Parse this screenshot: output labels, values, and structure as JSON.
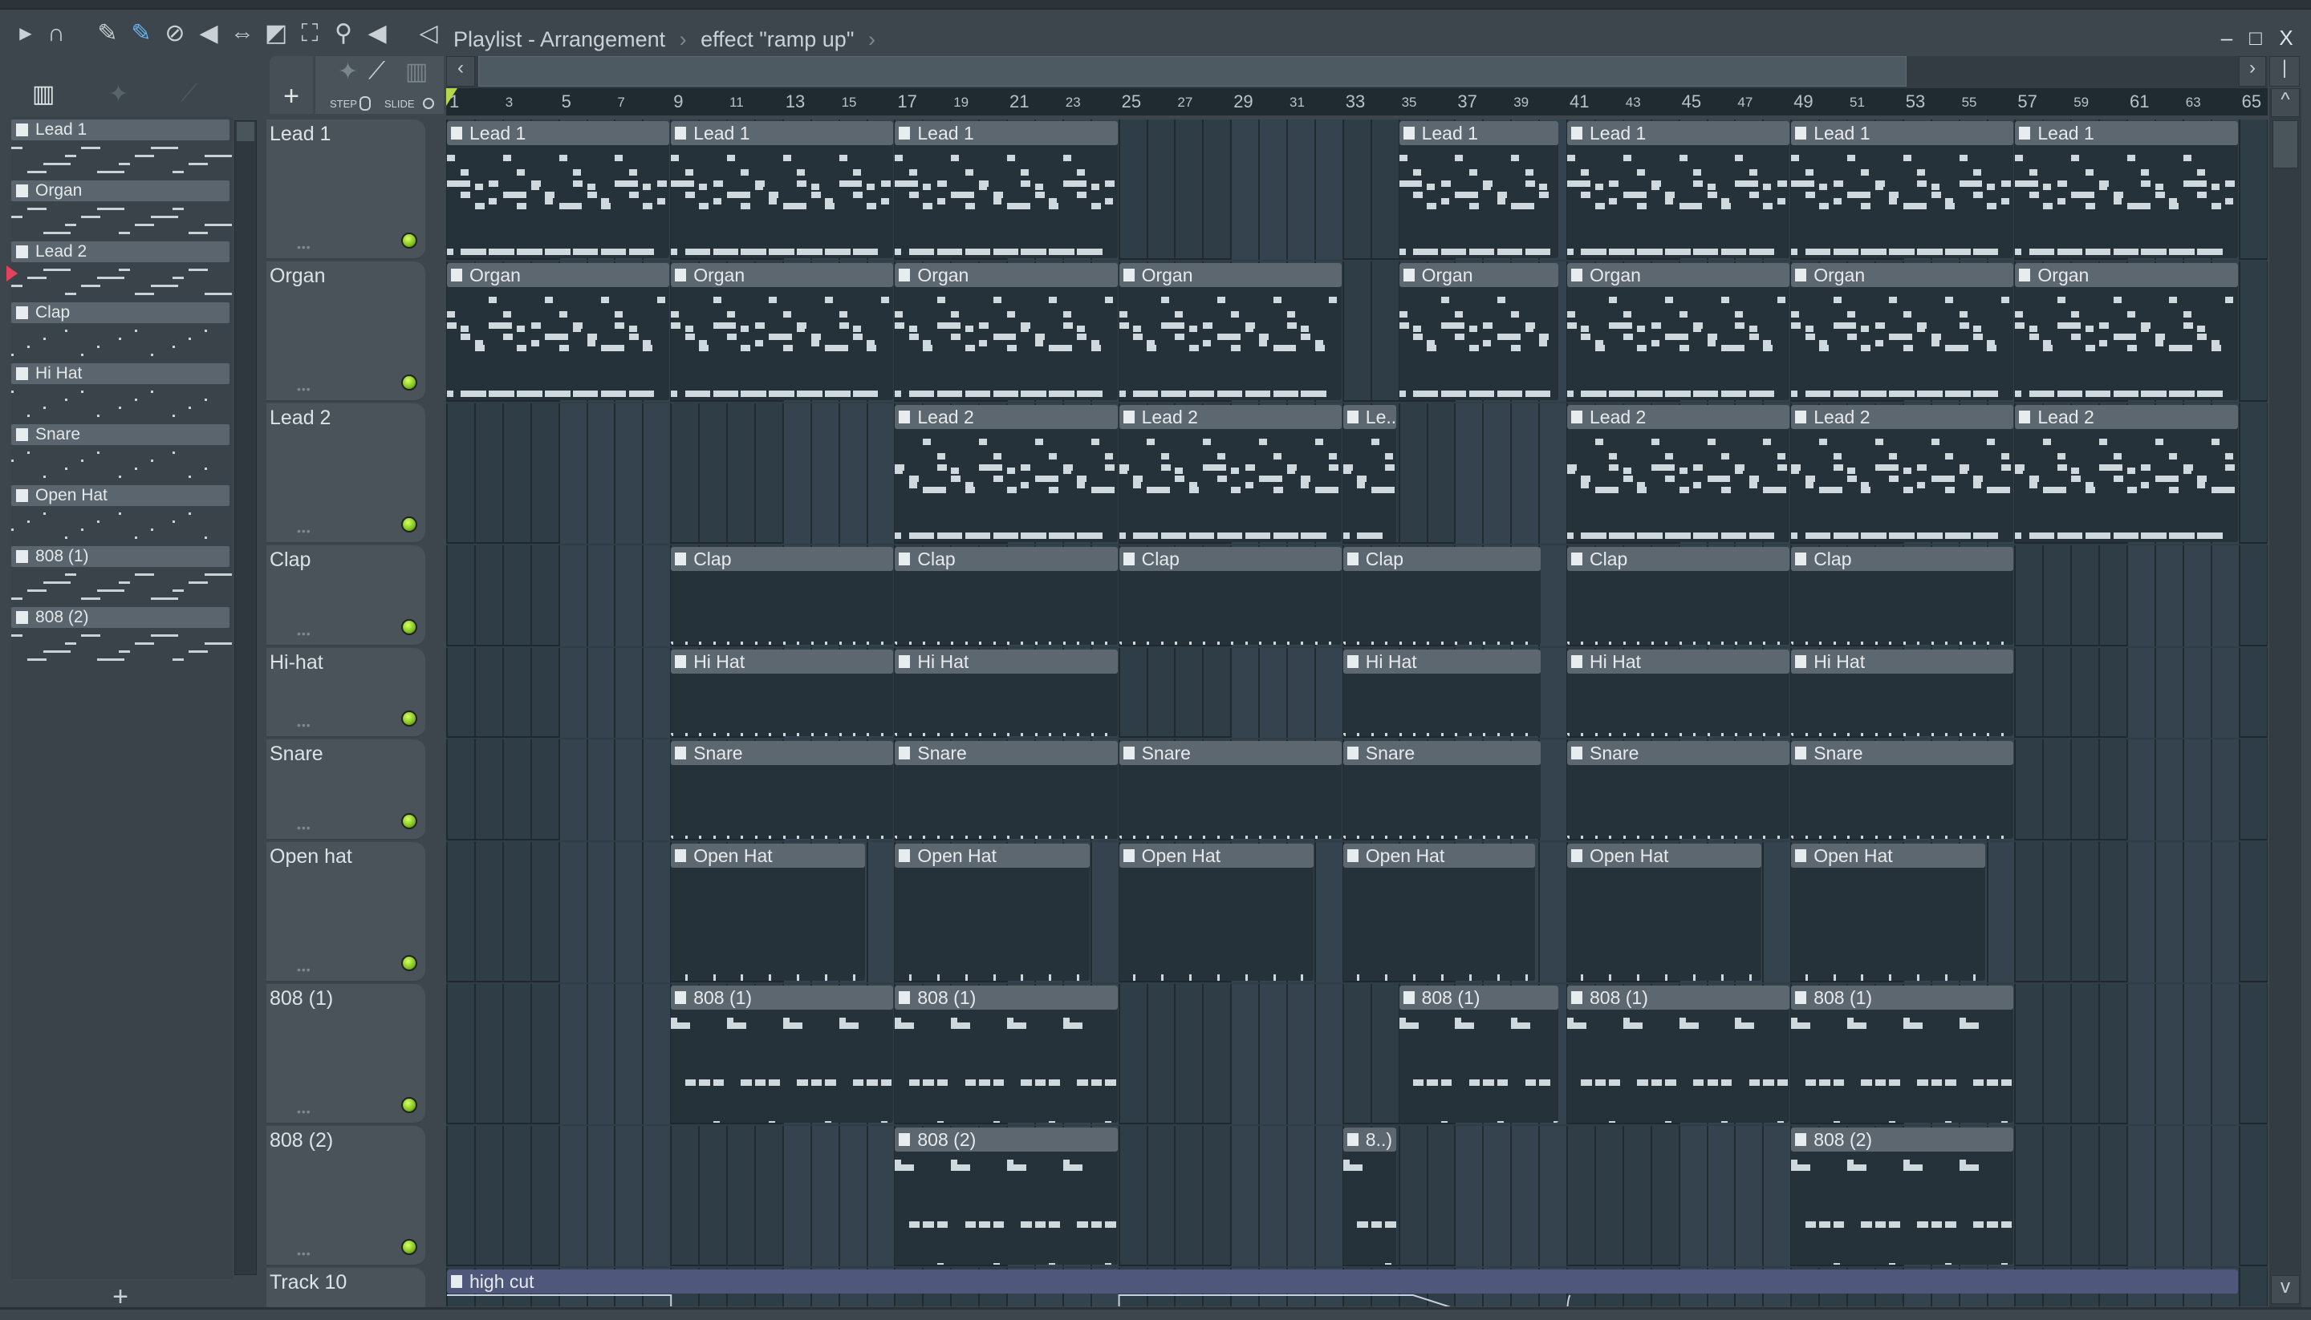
{
  "toolbar": {
    "icons": [
      "play-arrow",
      "magnet",
      "pencil",
      "paint-brush",
      "delete",
      "mute",
      "slip",
      "slice",
      "select",
      "zoom",
      "playback",
      "speaker"
    ],
    "title": "Playlist - Arrangement",
    "separator": "›",
    "subtitle": "effect \"ramp up\"",
    "window_controls": {
      "minimize": "–",
      "maximize": "□",
      "close": "X"
    }
  },
  "picker": {
    "patterns": [
      "Lead 1",
      "Organ",
      "Lead 2",
      "Clap",
      "Hi Hat",
      "Snare",
      "Open Hat",
      "808 (1)",
      "808 (2)"
    ],
    "selected": "Lead 2",
    "add_label": "+"
  },
  "playlist_tools": {
    "add_label": "+",
    "step_label": "STEP",
    "slide_label": "SLIDE"
  },
  "ruler": {
    "labels": [
      1,
      3,
      5,
      7,
      9,
      11,
      13,
      15,
      17,
      19,
      21,
      23,
      25,
      27,
      29,
      31,
      33,
      35,
      37,
      39,
      41,
      43,
      45,
      47,
      49,
      51,
      53,
      55,
      57,
      59,
      61,
      63,
      65
    ]
  },
  "tracks": [
    {
      "name": "Lead 1",
      "kind": "lead",
      "clips": [
        {
          "label": "Lead 1",
          "start": 1,
          "end": 9
        },
        {
          "label": "Lead 1",
          "start": 9,
          "end": 17
        },
        {
          "label": "Lead 1",
          "start": 17,
          "end": 25
        },
        {
          "label": "Lead 1",
          "start": 35,
          "end": 40.75
        },
        {
          "label": "Lead 1",
          "start": 41,
          "end": 49
        },
        {
          "label": "Lead 1",
          "start": 49,
          "end": 57
        },
        {
          "label": "Lead 1",
          "start": 57,
          "end": 65
        }
      ]
    },
    {
      "name": "Organ",
      "kind": "organ",
      "clips": [
        {
          "label": "Organ",
          "start": 1,
          "end": 9
        },
        {
          "label": "Organ",
          "start": 9,
          "end": 17
        },
        {
          "label": "Organ",
          "start": 17,
          "end": 25
        },
        {
          "label": "Organ",
          "start": 25,
          "end": 33
        },
        {
          "label": "Organ",
          "start": 35,
          "end": 40.75
        },
        {
          "label": "Organ",
          "start": 41,
          "end": 49
        },
        {
          "label": "Organ",
          "start": 49,
          "end": 57
        },
        {
          "label": "Organ",
          "start": 57,
          "end": 65
        }
      ]
    },
    {
      "name": "Lead 2",
      "kind": "lead2",
      "clips": [
        {
          "label": "Lead 2",
          "start": 17,
          "end": 25
        },
        {
          "label": "Lead 2",
          "start": 25,
          "end": 33
        },
        {
          "label": "Le..",
          "start": 33,
          "end": 34.95
        },
        {
          "label": "Lead 2",
          "start": 41,
          "end": 49
        },
        {
          "label": "Lead 2",
          "start": 49,
          "end": 57
        },
        {
          "label": "Lead 2",
          "start": 57,
          "end": 65
        }
      ]
    },
    {
      "name": "Clap",
      "kind": "perc",
      "clips": [
        {
          "label": "Clap",
          "start": 9,
          "end": 17
        },
        {
          "label": "Clap",
          "start": 17,
          "end": 25
        },
        {
          "label": "Clap",
          "start": 25,
          "end": 33
        },
        {
          "label": "Clap",
          "start": 33,
          "end": 40.1
        },
        {
          "label": "Clap",
          "start": 41,
          "end": 49
        },
        {
          "label": "Clap",
          "start": 49,
          "end": 57
        }
      ]
    },
    {
      "name": "Hi-hat",
      "kind": "perc",
      "clips": [
        {
          "label": "Hi Hat",
          "start": 9,
          "end": 17
        },
        {
          "label": "Hi Hat",
          "start": 17,
          "end": 25
        },
        {
          "label": "Hi Hat",
          "start": 33,
          "end": 40.1
        },
        {
          "label": "Hi Hat",
          "start": 41,
          "end": 49
        },
        {
          "label": "Hi Hat",
          "start": 49,
          "end": 57
        }
      ]
    },
    {
      "name": "Snare",
      "kind": "perc",
      "clips": [
        {
          "label": "Snare",
          "start": 9,
          "end": 17
        },
        {
          "label": "Snare",
          "start": 17,
          "end": 25
        },
        {
          "label": "Snare",
          "start": 25,
          "end": 33
        },
        {
          "label": "Snare",
          "start": 33,
          "end": 40.1
        },
        {
          "label": "Snare",
          "start": 41,
          "end": 49
        },
        {
          "label": "Snare",
          "start": 49,
          "end": 57
        }
      ]
    },
    {
      "name": "Open hat",
      "kind": "ticks",
      "clips": [
        {
          "label": "Open Hat",
          "start": 9,
          "end": 16
        },
        {
          "label": "Open Hat",
          "start": 17,
          "end": 24
        },
        {
          "label": "Open Hat",
          "start": 25,
          "end": 32
        },
        {
          "label": "Open Hat",
          "start": 33,
          "end": 39.9
        },
        {
          "label": "Open Hat",
          "start": 41,
          "end": 48
        },
        {
          "label": "Open Hat",
          "start": 49,
          "end": 56
        }
      ]
    },
    {
      "name": "808 (1)",
      "kind": "bass",
      "clips": [
        {
          "label": "808 (1)",
          "start": 9,
          "end": 17
        },
        {
          "label": "808 (1)",
          "start": 17,
          "end": 25
        },
        {
          "label": "808 (1)",
          "start": 35,
          "end": 40.75
        },
        {
          "label": "808 (1)",
          "start": 41,
          "end": 49
        },
        {
          "label": "808 (1)",
          "start": 49,
          "end": 57
        }
      ]
    },
    {
      "name": "808 (2)",
      "kind": "bass",
      "clips": [
        {
          "label": "808 (2)",
          "start": 17,
          "end": 25
        },
        {
          "label": "8..)",
          "start": 33,
          "end": 34.95
        },
        {
          "label": "808 (2)",
          "start": 49,
          "end": 57
        }
      ]
    },
    {
      "name": "Track 10",
      "kind": "auto",
      "clips": [
        {
          "label": "high cut",
          "start": 1,
          "end": 65
        }
      ]
    }
  ],
  "colors": {
    "clip_header": "#5d6770",
    "clip_body": "#26323a",
    "automation": "#4f577a",
    "led": "#8fd21f",
    "grid": "#2f3d46"
  }
}
